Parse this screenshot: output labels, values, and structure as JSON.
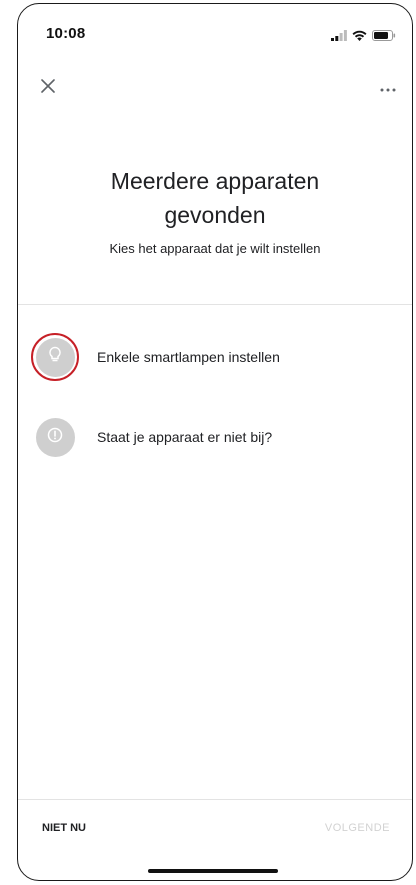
{
  "status_bar": {
    "time": "10:08",
    "icons": [
      "cellular-signal-icon",
      "wifi-icon",
      "battery-icon"
    ]
  },
  "top_bar": {
    "close_icon": "close-icon",
    "more_icon": "more-horizontal-icon"
  },
  "header": {
    "title": "Meerdere apparaten gevonden",
    "subtitle": "Kies het apparaat dat je wilt instellen"
  },
  "options": [
    {
      "label": "Enkele smartlampen instellen",
      "icon": "lightbulb-icon",
      "highlighted": true
    },
    {
      "label": "Staat je apparaat er niet bij?",
      "icon": "info-icon",
      "highlighted": false
    }
  ],
  "footer": {
    "secondary_label": "NIET NU",
    "primary_label": "VOLGENDE"
  },
  "colors": {
    "highlight_ring": "#c62027",
    "icon_bg": "#cfcfcf",
    "disabled_text": "#d2d2d2",
    "text": "#202124"
  }
}
